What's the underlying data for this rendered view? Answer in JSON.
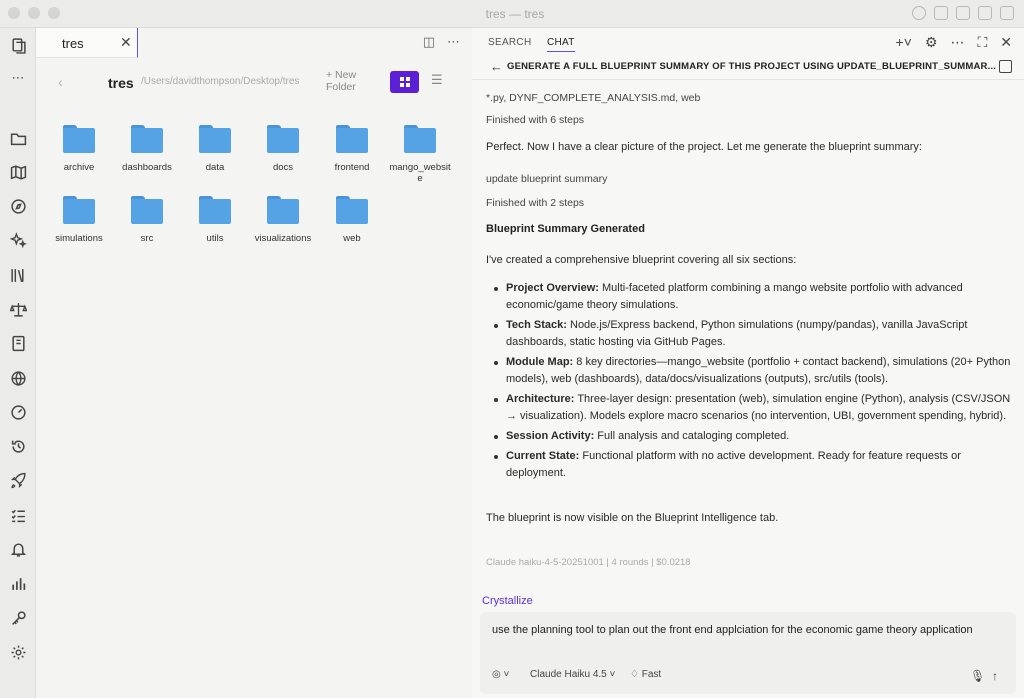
{
  "window": {
    "title": "tres — tres"
  },
  "tab": {
    "title": "tres",
    "close": "✕"
  },
  "explorer": {
    "folder_name": "tres",
    "path": "/Users/davidthompson/Desktop/tres",
    "new_folder_label": "+ New\nFolder",
    "items": [
      "archive",
      "dashboards",
      "data",
      "docs",
      "frontend",
      "mango_website",
      "simulations",
      "src",
      "utils",
      "visualizations",
      "web"
    ]
  },
  "panel": {
    "tabs": {
      "search": "SEARCH",
      "chat": "CHAT"
    },
    "conversation_title": "GENERATE A FULL BLUEPRINT SUMMARY OF THIS PROJECT USING UPDATE_BLUEPRINT_SUMMAR...",
    "messages": {
      "line1": "*.py, DYNF_COMPLETE_ANALYSIS.md, web",
      "line2": "Finished with 6 steps",
      "line3": "Perfect. Now I have a clear picture of the project. Let me generate the blueprint summary:",
      "line4": "update blueprint summary",
      "line5": "Finished with 2 steps",
      "heading": "Blueprint Summary Generated",
      "intro": "I've created a comprehensive blueprint covering all six sections:",
      "bullets": [
        {
          "label": "Project Overview:",
          "text": " Multi-faceted platform combining a mango website portfolio with advanced economic/game theory simulations."
        },
        {
          "label": "Tech Stack:",
          "text": " Node.js/Express backend, Python simulations (numpy/pandas), vanilla JavaScript dashboards, static hosting via GitHub Pages."
        },
        {
          "label": "Module Map:",
          "text": " 8 key directories—mango_website (portfolio + contact backend), simulations (20+ Python models), web (dashboards), data/docs/visualizations (outputs), src/utils (tools)."
        },
        {
          "label": "Architecture:",
          "text": " Three-layer design: presentation (web), simulation engine (Python), analysis (CSV/JSON → visualization). Models explore macro scenarios (no intervention, UBI, government spending, hybrid)."
        },
        {
          "label": "Session Activity:",
          "text": " Full analysis and cataloging completed."
        },
        {
          "label": "Current State:",
          "text": " Functional platform with no active development. Ready for feature requests or deployment."
        }
      ],
      "outro": "The blueprint is now visible on the Blueprint Intelligence tab.",
      "meta": "Claude haiku-4-5-20251001 | 4 rounds | $0.0218"
    },
    "crystallize": "Crystallize",
    "composer": {
      "text": "use the planning tool to plan out the front end applciation for the economic game theory application",
      "model": "Claude Haiku 4.5",
      "speed": "Fast"
    }
  }
}
